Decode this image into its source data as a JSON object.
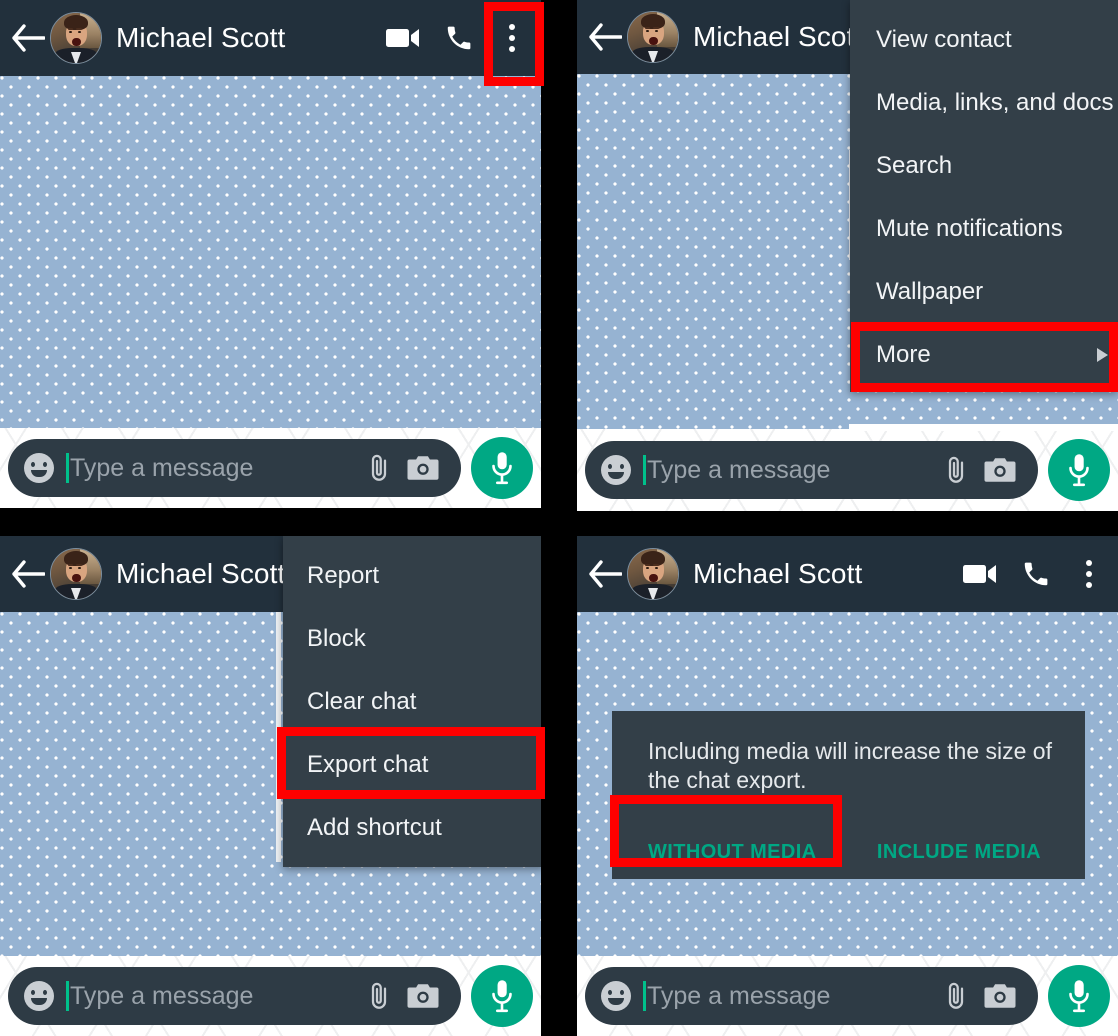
{
  "app": {
    "contact_name": "Michael Scott",
    "accent_color": "#00a884",
    "header_color": "#22303c",
    "menu_color": "#333f48",
    "highlight_color": "#ff0000",
    "wallpaper_color": "#96b3d2"
  },
  "composer": {
    "placeholder": "Type a message",
    "emoji_icon": "smiley-icon",
    "attach_icon": "paperclip-icon",
    "camera_icon": "camera-icon",
    "mic_icon": "microphone-icon"
  },
  "header_icons": {
    "back": "back-arrow-icon",
    "video": "video-call-icon",
    "voice": "voice-call-icon",
    "overflow": "overflow-menu-icon"
  },
  "panels": [
    {
      "id": "panel-1",
      "step": 1,
      "description": "Chat screen with overflow menu highlighted",
      "shows_video_icon": true,
      "shows_call_icon": true,
      "shows_overflow_icon": true
    },
    {
      "id": "panel-2",
      "step": 2,
      "description": "Overflow menu open with More highlighted"
    },
    {
      "id": "panel-3",
      "step": 3,
      "description": "More submenu open with Export chat highlighted"
    },
    {
      "id": "panel-4",
      "step": 4,
      "description": "Export chat dialog with WITHOUT MEDIA highlighted",
      "shows_video_icon": true,
      "shows_call_icon": true,
      "shows_overflow_icon": true
    }
  ],
  "overflow_menu": {
    "items": [
      {
        "label": "View contact",
        "has_submenu": false,
        "highlighted": false
      },
      {
        "label": "Media, links, and docs",
        "has_submenu": false,
        "highlighted": false
      },
      {
        "label": "Search",
        "has_submenu": false,
        "highlighted": false
      },
      {
        "label": "Mute notifications",
        "has_submenu": false,
        "highlighted": false
      },
      {
        "label": "Wallpaper",
        "has_submenu": false,
        "highlighted": false
      },
      {
        "label": "More",
        "has_submenu": true,
        "highlighted": true
      }
    ]
  },
  "more_submenu": {
    "items": [
      {
        "label": "Report",
        "highlighted": false
      },
      {
        "label": "Block",
        "highlighted": false
      },
      {
        "label": "Clear chat",
        "highlighted": false
      },
      {
        "label": "Export chat",
        "highlighted": true
      },
      {
        "label": "Add shortcut",
        "highlighted": false
      }
    ]
  },
  "export_dialog": {
    "message": "Including media will increase the size of the chat export.",
    "without_media_label": "WITHOUT MEDIA",
    "include_media_label": "INCLUDE MEDIA",
    "highlighted_action": "WITHOUT MEDIA"
  }
}
